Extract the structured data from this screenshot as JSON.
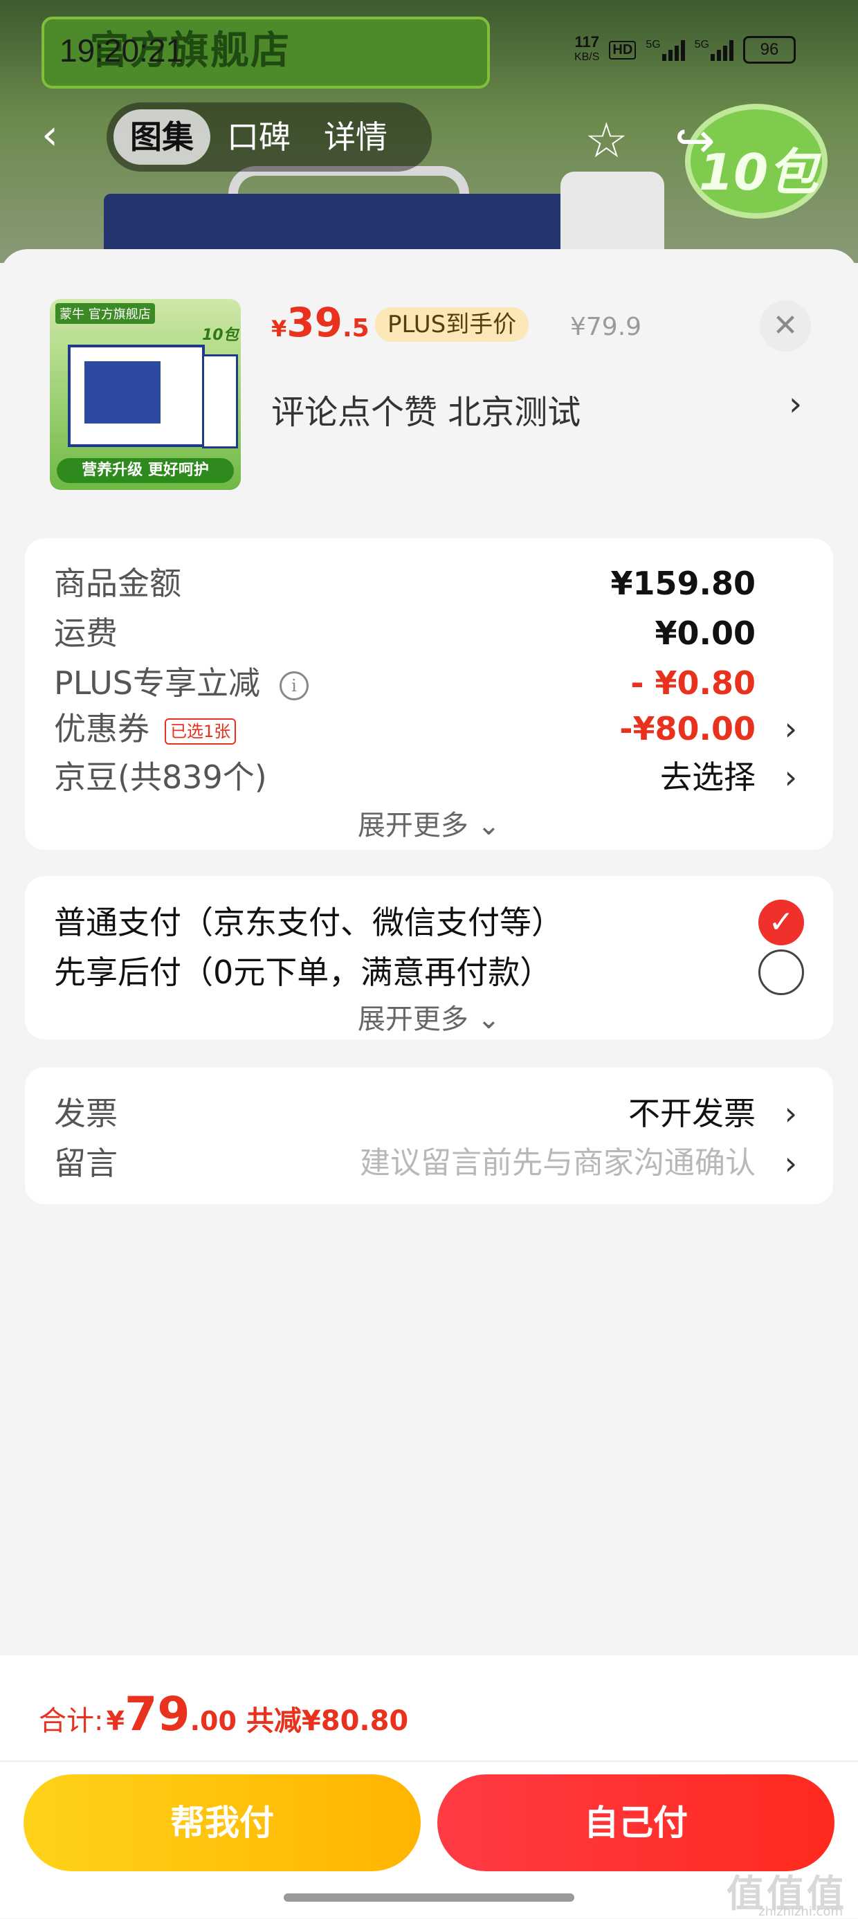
{
  "status_bar": {
    "time": "19:20:21",
    "net_speed": "117",
    "net_unit": "KB/S",
    "hd": "HD",
    "sig1": "5G",
    "sig2": "5G",
    "battery": "96"
  },
  "background": {
    "store_banner": "官方旗舰店",
    "badge": "10包"
  },
  "nav": {
    "tabs": [
      "图集",
      "口碑",
      "详情"
    ],
    "active_tab": 0
  },
  "product": {
    "thumb_logo": "蒙牛 官方旗舰店",
    "thumb_ten": "10包",
    "thumb_slogan": "营养升级 更好呵护",
    "price_symbol": "¥",
    "price_int": "39",
    "price_dec": ".5",
    "plus_tag": "PLUS到手价",
    "orig_price": "¥79.9",
    "address": "评论点个赞  北京测试"
  },
  "fees": {
    "rows": [
      {
        "label": "商品金额",
        "value": "¥159.80"
      },
      {
        "label": "运费",
        "value": "¥0.00"
      },
      {
        "label": "PLUS专享立减",
        "value": "- ¥0.80"
      },
      {
        "label": "优惠券",
        "tag": "已选1张",
        "value": "-¥80.00"
      },
      {
        "label": "京豆(共839个)",
        "value": "去选择"
      }
    ],
    "expand": "展开更多 ⌄"
  },
  "payment": {
    "options": [
      {
        "label": "普通支付（京东支付、微信支付等）",
        "selected": true
      },
      {
        "label": "先享后付（0元下单，满意再付款）",
        "selected": false
      }
    ],
    "expand": "展开更多 ⌄"
  },
  "extras": {
    "invoice_label": "发票",
    "invoice_value": "不开发票",
    "message_label": "留言",
    "message_placeholder": "建议留言前先与商家沟通确认"
  },
  "footer": {
    "total_label": "合计:",
    "total_symbol": "¥",
    "total_int": "79",
    "total_dec": ".00",
    "total_save": "共减¥80.80",
    "help_pay": "帮我付",
    "self_pay": "自己付"
  },
  "watermark": {
    "main": "值值值",
    "sub": "zhizhizhi.com"
  },
  "colors": {
    "accent_red": "#e8321e",
    "button_yellow": "#ffc20a",
    "button_red": "#ff3236"
  }
}
